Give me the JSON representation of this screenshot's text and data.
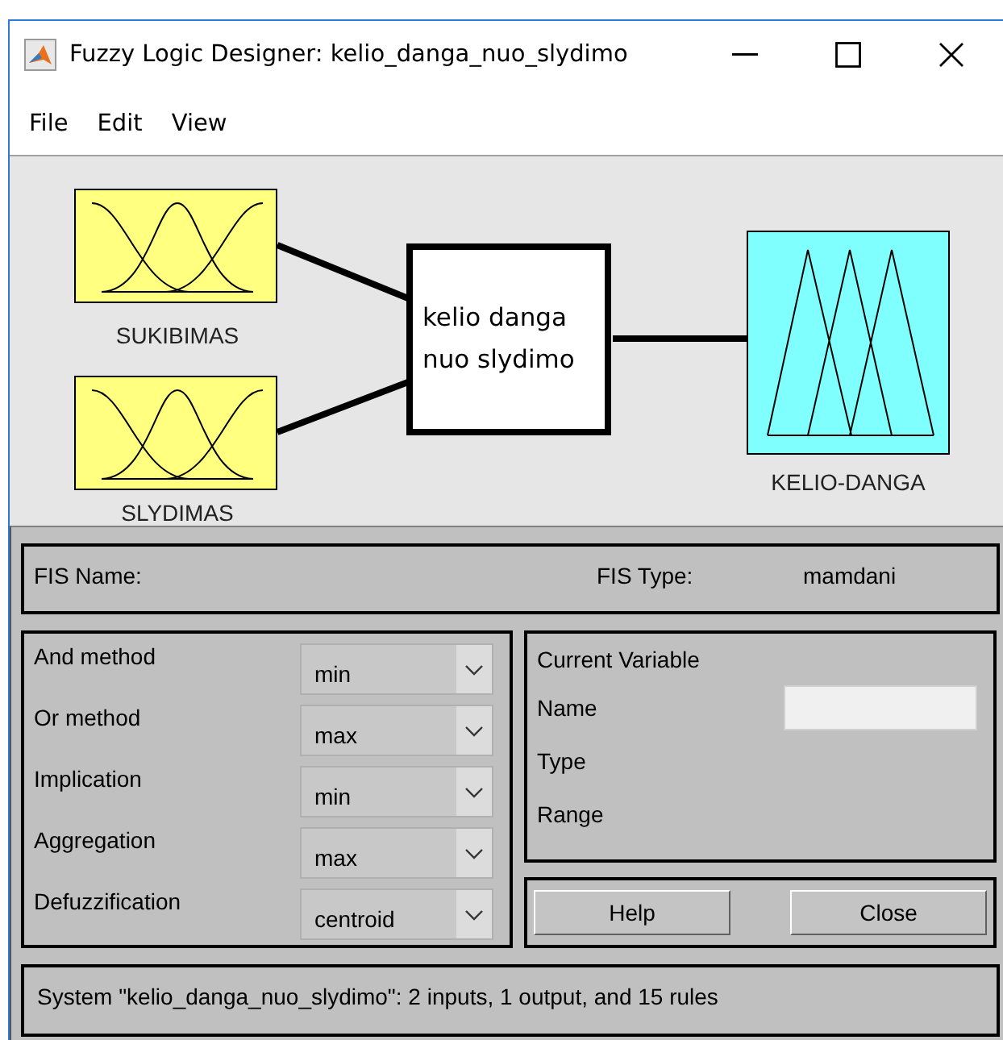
{
  "window": {
    "title": "Fuzzy Logic Designer: kelio_danga_nuo_slydimo"
  },
  "menu": [
    "File",
    "Edit",
    "View"
  ],
  "diagram": {
    "inputs": [
      {
        "name": "SUKIBIMAS",
        "kind": "gaussian"
      },
      {
        "name": "SLYDIMAS",
        "kind": "gaussian"
      }
    ],
    "system": {
      "name": "kelio danga nuo slydimo"
    },
    "output": {
      "name": "KELIO-DANGA",
      "kind": "triangular"
    }
  },
  "fis": {
    "name_label": "FIS Name:",
    "type_label": "FIS Type:",
    "type_value": "mamdani"
  },
  "methods": [
    {
      "label": "And method",
      "value": "min"
    },
    {
      "label": "Or method",
      "value": "max"
    },
    {
      "label": "Implication",
      "value": "min"
    },
    {
      "label": "Aggregation",
      "value": "max"
    },
    {
      "label": "Defuzzification",
      "value": "centroid"
    }
  ],
  "current_variable": {
    "title": "Current Variable",
    "fields": [
      {
        "label": "Name",
        "kind": "field"
      },
      {
        "label": "Type",
        "kind": "text"
      },
      {
        "label": "Range",
        "kind": "text"
      }
    ]
  },
  "buttons": [
    "Help",
    "Close"
  ],
  "status": "System \"kelio_danga_nuo_slydimo\": 2 inputs, 1 output, and 15 rules"
}
